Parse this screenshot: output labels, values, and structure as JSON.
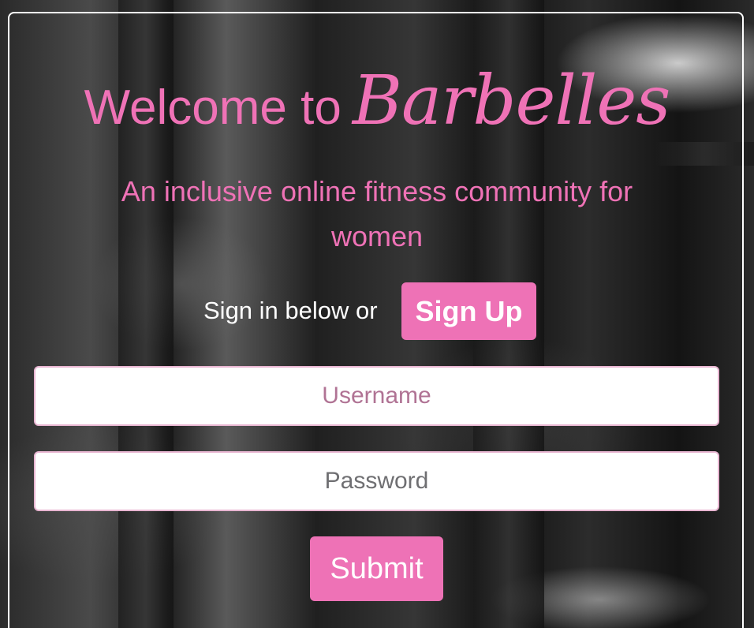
{
  "header": {
    "title_lead": "Welcome to",
    "title_brand": "Barbelles",
    "subtitle": "An inclusive online fitness community for women"
  },
  "signin": {
    "prompt": "Sign in below or",
    "signup_label": "Sign Up"
  },
  "form": {
    "username_placeholder": "Username",
    "username_value": "",
    "password_placeholder": "Password",
    "password_value": "",
    "submit_label": "Submit"
  },
  "colors": {
    "accent": "#ee72b6",
    "text_light": "#ffffff",
    "field_border": "#e9b6d2"
  }
}
